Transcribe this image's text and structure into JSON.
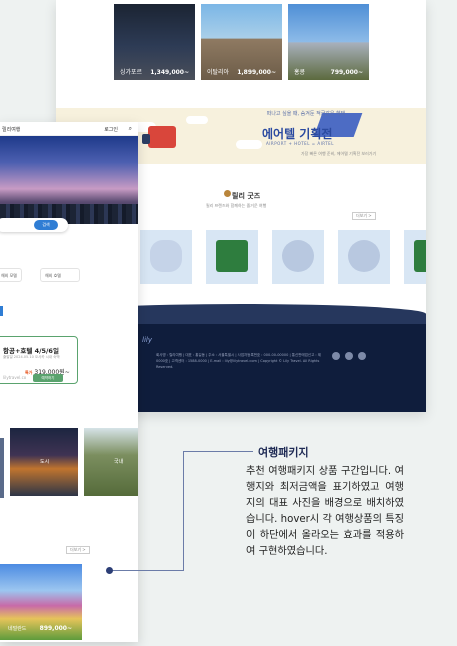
{
  "desktop": {
    "destinations": [
      {
        "name": "싱가포르",
        "price": "1,349,000~"
      },
      {
        "name": "이탈리아",
        "price": "1,899,000~"
      },
      {
        "name": "홍콩",
        "price": "799,000~"
      }
    ],
    "banner": {
      "line1": "떠나고 싶을 때, 숨겨둔 적금같은 혜택",
      "headline": "에어텔 기획전",
      "tags": "AIRPORT + HOTEL = AIRTEL",
      "note": "가장 빠른 여행 준비, 에어텔 기획전 보러가기"
    },
    "goods": {
      "title": "릴리 굿즈",
      "subtitle": "릴리 프렌즈와 함께하는 즐거운 여행",
      "more": "더보기 >"
    },
    "footer": {
      "logo": "lily",
      "info": "회사명 : 릴리여행 | 대표 : 홍길동 | 주소 : 서울특별시 | 사업자등록번호 : 000-00-00000 | 통신판매업신고 : 제0000호 | 고객센터 : 1588-0000 | E-mail : lily@lilytravel.com | Copyright © Lily Travel. All Rights Reserved."
    }
  },
  "mobile": {
    "header": {
      "title": "릴리여행",
      "login": "로그인"
    },
    "search_button": "검색",
    "chips": [
      "해외 모텔",
      "해외 호텔"
    ],
    "deal": {
      "title": "항공+호텔 4/5/6일",
      "small": "출발일 2024.05.10\n오사카 시내 숙박",
      "price_label": "특가",
      "price": "319,000원~",
      "input_placeholder": "lilytravel.co",
      "button": "예약하기"
    },
    "tiles": [
      {
        "name": "도시"
      },
      {
        "name": "국내"
      }
    ],
    "more": "더보기 >",
    "big": {
      "name": "네덜란드",
      "price": "899,000~"
    }
  },
  "annotation": {
    "title": "여행패키지",
    "body": "추천 여행패키지 상품 구간입니다. 여행지와 최저금액을 표기하였고 여행지의 대표 사진을 배경으로 배치하였습니다. hover시 각 여행상품의 특징이 하단에서 올라오는 효과를 적용하여 구현하였습니다."
  },
  "colors": {
    "background": "#eef2f1",
    "accent_blue": "#2f7dd4",
    "footer_navy": "#0f1d3c",
    "annotation_navy": "#1f2b55",
    "deal_green": "#5aa36e"
  }
}
